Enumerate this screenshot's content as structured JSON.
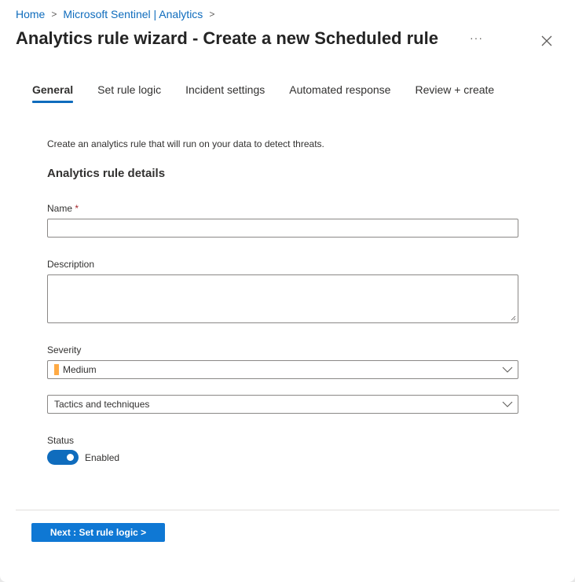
{
  "breadcrumb": {
    "items": [
      "Home",
      "Microsoft Sentinel | Analytics"
    ],
    "separator": ">"
  },
  "header": {
    "title": "Analytics rule wizard - Create a new Scheduled rule",
    "more_label": "···",
    "close_icon": "close-icon"
  },
  "tabs": [
    {
      "label": "General",
      "active": true
    },
    {
      "label": "Set rule logic",
      "active": false
    },
    {
      "label": "Incident settings",
      "active": false
    },
    {
      "label": "Automated response",
      "active": false
    },
    {
      "label": "Review + create",
      "active": false
    }
  ],
  "form": {
    "intro": "Create an analytics rule that will run on your data to detect threats.",
    "section_title": "Analytics rule details",
    "name": {
      "label": "Name",
      "required_mark": "*",
      "value": ""
    },
    "description": {
      "label": "Description",
      "value": ""
    },
    "severity": {
      "label": "Severity",
      "value": "Medium",
      "color": "#ffaa44"
    },
    "tactics": {
      "placeholder": "Tactics and techniques"
    },
    "status": {
      "label": "Status",
      "toggle_label": "Enabled",
      "on": true
    }
  },
  "footer": {
    "next_button": "Next : Set rule logic >"
  },
  "colors": {
    "accent": "#0f6cbd",
    "primary_button": "#0f78d4",
    "severity_medium": "#ffaa44"
  }
}
